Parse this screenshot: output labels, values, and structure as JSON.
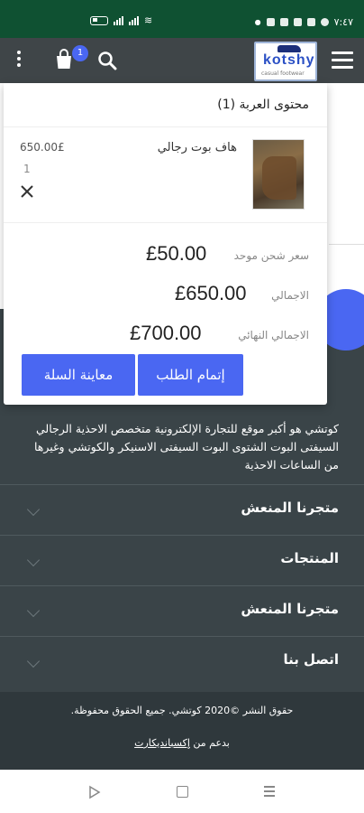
{
  "status_bar": {
    "time": "٧:٤٧"
  },
  "header": {
    "cart_count": "1",
    "logo_text": "kotshy",
    "logo_tagline": "casual footwear"
  },
  "cart": {
    "title": "محتوى العربة (1)",
    "item": {
      "name": "هاف بوت رجالي",
      "price": "650.00£",
      "quantity": "1"
    },
    "shipping_label": "سعر شحن موحد",
    "shipping_value": "£50.00",
    "subtotal_label": "الاجمالي",
    "subtotal_value": "£650.00",
    "total_label": "الاجمالي النهائي",
    "total_value": "£700.00",
    "checkout_button": "إتمام الطلب",
    "view_cart_button": "معاينة السلة"
  },
  "footer": {
    "about": "كوتشي هو أكبر موقع للتجارة الإلكترونية متخصص الاحذية الرجالي السيفتى البوت الشتوى البوت السيفتى الاسنيكر والكوتشي وغيرها من الساعات الاحذية",
    "sections": [
      {
        "title": "متجرنا المنعش"
      },
      {
        "title": "المنتجات"
      },
      {
        "title": "متجرنا المنعش"
      },
      {
        "title": "اتصل بنا"
      }
    ],
    "copyright": "حقوق النشر ©2020 كوتشي. جميع الحقوق محفوظة.",
    "powered_prefix": "بدعم من ",
    "powered_link": "إكسبانديكارت"
  },
  "colors": {
    "accent": "#4a67f2",
    "header_bg": "#3f4548",
    "footer_bg": "#3a4448",
    "status_bar_bg": "#0f5132"
  }
}
